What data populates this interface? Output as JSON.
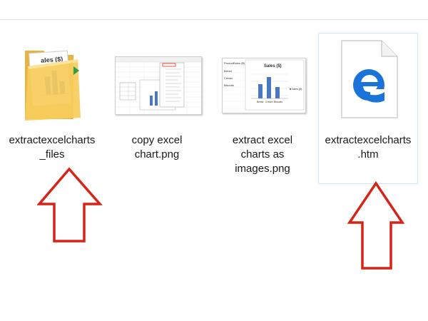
{
  "files": [
    {
      "name": "extractexcelcharts\n_files",
      "type": "folder"
    },
    {
      "name": "copy excel\nchart.png",
      "type": "image"
    },
    {
      "name": "extract excel\ncharts as\nimages.png",
      "type": "image"
    },
    {
      "name": "extractexcelcharts\n.htm",
      "type": "edge-html",
      "selected": true
    }
  ],
  "thumbnails": {
    "folder_chart_title": "ales ($)",
    "chart_title": "Sales ($)",
    "table_header": [
      "Product",
      "Sales ($)"
    ],
    "table_rows": [
      "Bread",
      "Cream",
      "Biscuits"
    ],
    "legend": "■ Sales ($)",
    "x_labels": [
      "Bread",
      "Cream",
      "Biscuits"
    ]
  },
  "icons": {
    "edge_blue": "#1a73d9",
    "folder_yellow": "#f6cc5b",
    "arrow_red": "#d62418"
  }
}
